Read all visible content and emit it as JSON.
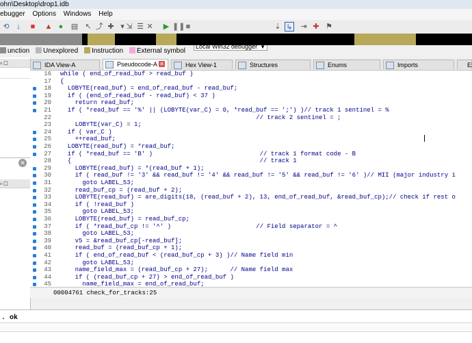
{
  "window": {
    "title": "ohn\\Desktop\\drop1.idb"
  },
  "menu": [
    "ebugger",
    "Options",
    "Windows",
    "Help"
  ],
  "toolbar": {
    "debugger_select": "Local Win32 debugger"
  },
  "legend": [
    {
      "label": "unction",
      "color": "#8d8d8d"
    },
    {
      "label": "Unexplored",
      "color": "#b9b9b9"
    },
    {
      "label": "Instruction",
      "color": "#b7a85a"
    },
    {
      "label": "External symbol",
      "color": "#f5a8dd"
    }
  ],
  "tabs": [
    {
      "label": "IDA View-A",
      "active": false
    },
    {
      "label": "Pseudocode-A",
      "active": true
    },
    {
      "label": "Hex View-1",
      "active": false
    },
    {
      "label": "Structures",
      "active": false
    },
    {
      "label": "Enums",
      "active": false
    },
    {
      "label": "Imports",
      "active": false
    },
    {
      "label": "Ex",
      "active": false
    }
  ],
  "code_lines": [
    {
      "n": "16",
      "dot": false,
      "t": "while ( end_of_read_buf > read_buf )"
    },
    {
      "n": "17",
      "dot": false,
      "t": "{"
    },
    {
      "n": "18",
      "dot": true,
      "t": "  LOBYTE(read_buf) = end_of_read_buf - read_buf;"
    },
    {
      "n": "19",
      "dot": true,
      "t": "  if ( (end_of_read_buf - read_buf) < 37 )"
    },
    {
      "n": "20",
      "dot": true,
      "t": "    return read_buf;"
    },
    {
      "n": "21",
      "dot": true,
      "t": "  if ( *read_buf == '%' || (LOBYTE(var_C) = 0, *read_buf == ';') )// track 1 sentinel = %"
    },
    {
      "n": "22",
      "dot": false,
      "t": "                                                     // track 2 sentinel = ;"
    },
    {
      "n": "23",
      "dot": false,
      "t": "    LOBYTE(var_C) = 1;"
    },
    {
      "n": "24",
      "dot": true,
      "t": "  if ( var_C )"
    },
    {
      "n": "25",
      "dot": true,
      "t": "    ++read_buf;"
    },
    {
      "n": "26",
      "dot": true,
      "t": "  LOBYTE(read_buf) = *read_buf;"
    },
    {
      "n": "27",
      "dot": true,
      "t": "  if ( *read_buf == 'B' )                             // track 1 format code - B"
    },
    {
      "n": "28",
      "dot": false,
      "t": "  {                                                   // track 1"
    },
    {
      "n": "29",
      "dot": true,
      "t": "    LOBYTE(read_buf) = *(read_buf + 1);"
    },
    {
      "n": "30",
      "dot": true,
      "t": "    if ( read_buf != '3' && read_buf != '4' && read_buf != '5' && read_buf != '6' )// MII (major industry i"
    },
    {
      "n": "31",
      "dot": true,
      "t": "      goto LABEL_53;"
    },
    {
      "n": "32",
      "dot": true,
      "t": "    read_buf_cp = (read_buf + 2);"
    },
    {
      "n": "33",
      "dot": true,
      "t": "    LOBYTE(read_buf) = are_digits(18, (read_buf + 2), 13, end_of_read_buf, &read_buf_cp);// check if rest o"
    },
    {
      "n": "34",
      "dot": true,
      "t": "    if ( !read_buf )"
    },
    {
      "n": "35",
      "dot": true,
      "t": "      goto LABEL_53;"
    },
    {
      "n": "36",
      "dot": true,
      "t": "    LOBYTE(read_buf) = read_buf_cp;"
    },
    {
      "n": "37",
      "dot": true,
      "t": "    if ( *read_buf_cp != '^' )                       // Field separator = ^"
    },
    {
      "n": "38",
      "dot": true,
      "t": "      goto LABEL_53;"
    },
    {
      "n": "39",
      "dot": true,
      "t": "    v5 = &read_buf_cp[-read_buf];"
    },
    {
      "n": "40",
      "dot": true,
      "t": "    read_buf = (read_buf_cp + 1);"
    },
    {
      "n": "41",
      "dot": true,
      "t": "    if ( end_of_read_buf < (read_buf_cp + 3) )// Name field min"
    },
    {
      "n": "42",
      "dot": true,
      "t": "      goto LABEL_53;"
    },
    {
      "n": "43",
      "dot": true,
      "t": "    name_field_max = (read_buf_cp + 27);      // Name field max"
    },
    {
      "n": "44",
      "dot": true,
      "t": "    if ( (read_buf_cp + 27) > end_of_read_buf )"
    },
    {
      "n": "45",
      "dot": true,
      "t": "      name_field_max = end_of_read_buf;"
    }
  ],
  "status_line": "00004761 check_for_tracks:25",
  "output": {
    "text": ". ok"
  },
  "colors": {
    "accent_blue": "#2a7fd4",
    "code_text": "#00008b",
    "title_bg": "#dfe7f1"
  }
}
